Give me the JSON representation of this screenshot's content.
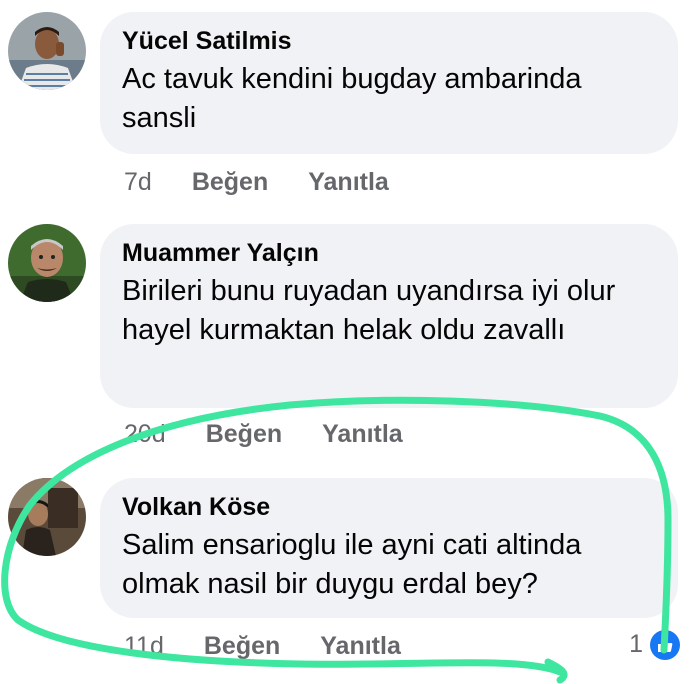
{
  "comments": [
    {
      "author": "Yücel Satilmis",
      "text": "Ac tavuk kendini bugday ambarinda sansli",
      "time": "7d",
      "like_label": "Beğen",
      "reply_label": "Yanıtla"
    },
    {
      "author": "Muammer Yalçın",
      "text": "Birileri bunu ruyadan uyandırsa iyi olur hayel kurmaktan helak oldu zavallı",
      "time": "20d",
      "like_label": "Beğen",
      "reply_label": "Yanıtla"
    },
    {
      "author": "Volkan Köse",
      "text": "Salim ensarioglu ile ayni cati altinda olmak nasil bir duygu erdal bey?",
      "time": "11d",
      "like_label": "Beğen",
      "reply_label": "Yanıtla",
      "reaction_count": "1",
      "reaction_icon": "thumbs-up-icon"
    }
  ],
  "colors": {
    "bubble": "#f0f2f5",
    "meta_text": "#65676b",
    "highlight_stroke": "#3ee6a0",
    "like_blue": "#1877f2"
  }
}
